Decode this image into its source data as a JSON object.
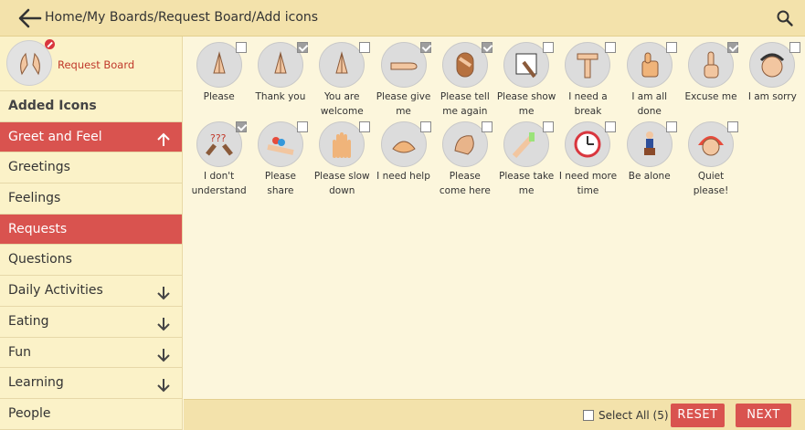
{
  "header": {
    "breadcrumb": "Home/My Boards/Request Board/Add icons"
  },
  "board": {
    "name": "Request Board"
  },
  "sidebar": {
    "heading": "Added Icons",
    "items": [
      {
        "label": "Greet and Feel",
        "active": true,
        "arrow": "up"
      },
      {
        "label": "Greetings",
        "active": false,
        "arrow": ""
      },
      {
        "label": "Feelings",
        "active": false,
        "arrow": ""
      },
      {
        "label": "Requests",
        "active": true,
        "arrow": ""
      },
      {
        "label": "Questions",
        "active": false,
        "arrow": ""
      },
      {
        "label": "Daily Activities",
        "active": false,
        "arrow": "down"
      },
      {
        "label": "Eating",
        "active": false,
        "arrow": "down"
      },
      {
        "label": "Fun",
        "active": false,
        "arrow": "down"
      },
      {
        "label": "Learning",
        "active": false,
        "arrow": "down"
      },
      {
        "label": "People",
        "active": false,
        "arrow": ""
      }
    ]
  },
  "icons": [
    {
      "label": "Please",
      "checked": false,
      "icon": "praying-hands-icon"
    },
    {
      "label": "Thank you",
      "checked": true,
      "icon": "praying-hands-icon"
    },
    {
      "label": "You are welcome",
      "checked": false,
      "icon": "praying-hands-icon"
    },
    {
      "label": "Please give me",
      "checked": true,
      "icon": "open-palm-icon"
    },
    {
      "label": "Please tell me again",
      "checked": true,
      "icon": "ear-hand-icon"
    },
    {
      "label": "Please show me",
      "checked": false,
      "icon": "pointing-board-icon"
    },
    {
      "label": "I need a break",
      "checked": false,
      "icon": "time-out-hands-icon"
    },
    {
      "label": "I am all done",
      "checked": false,
      "icon": "thumbs-up-icon"
    },
    {
      "label": "Excuse me",
      "checked": true,
      "icon": "raised-finger-icon"
    },
    {
      "label": "I am sorry",
      "checked": false,
      "icon": "sorry-face-icon"
    },
    {
      "label": "I don't understand",
      "checked": true,
      "icon": "question-hands-icon"
    },
    {
      "label": "Please share",
      "checked": false,
      "icon": "share-hands-icon"
    },
    {
      "label": "Please slow down",
      "checked": false,
      "icon": "slow-hand-icon"
    },
    {
      "label": "I need help",
      "checked": false,
      "icon": "help-hand-icon"
    },
    {
      "label": "Please come here",
      "checked": false,
      "icon": "come-hand-icon"
    },
    {
      "label": "Please take me",
      "checked": false,
      "icon": "take-hand-icon"
    },
    {
      "label": "I need more time",
      "checked": false,
      "icon": "clock-icon"
    },
    {
      "label": "Be alone",
      "checked": false,
      "icon": "sitting-person-icon"
    },
    {
      "label": "Quiet please!",
      "checked": false,
      "icon": "quiet-face-icon"
    }
  ],
  "footer": {
    "select_all_label": "Select All (5)",
    "reset_label": "RESET",
    "next_label": "NEXT"
  },
  "colors": {
    "accent": "#d9534f",
    "topbar": "#f3e2ab",
    "sidebar": "#fbf2c8",
    "content": "#fcf6dc"
  }
}
